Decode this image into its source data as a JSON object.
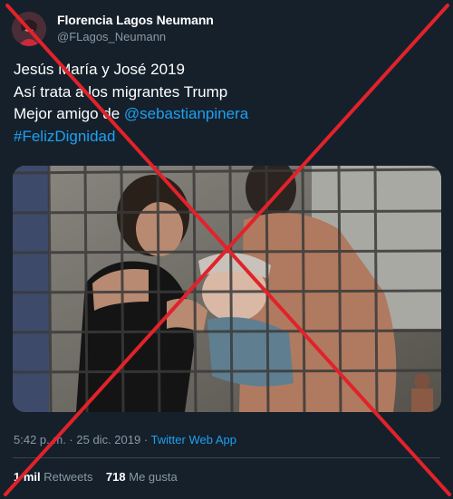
{
  "author": {
    "display_name": "Florencia Lagos Neumann",
    "handle": "@FLagos_Neumann"
  },
  "tweet": {
    "line1": "Jesús María y José 2019",
    "line2": "Así trata a los migrantes Trump",
    "line3_prefix": "Mejor amigo de ",
    "mention": "@sebastianpinera",
    "hashtag": "#FelizDignidad"
  },
  "meta": {
    "time": "5:42 p. m.",
    "separator1": " · ",
    "date": "25 dic. 2019",
    "separator2": " · ",
    "app": "Twitter Web App"
  },
  "stats": {
    "retweets_count": "1 mil",
    "retweets_label": "Retweets",
    "likes_count": "718",
    "likes_label": "Me gusta"
  },
  "overlay": {
    "cross_color": "#e2222a"
  },
  "colors": {
    "background": "#15202b",
    "link": "#1da1f2",
    "muted": "#8899a6",
    "divider": "#38444d"
  }
}
